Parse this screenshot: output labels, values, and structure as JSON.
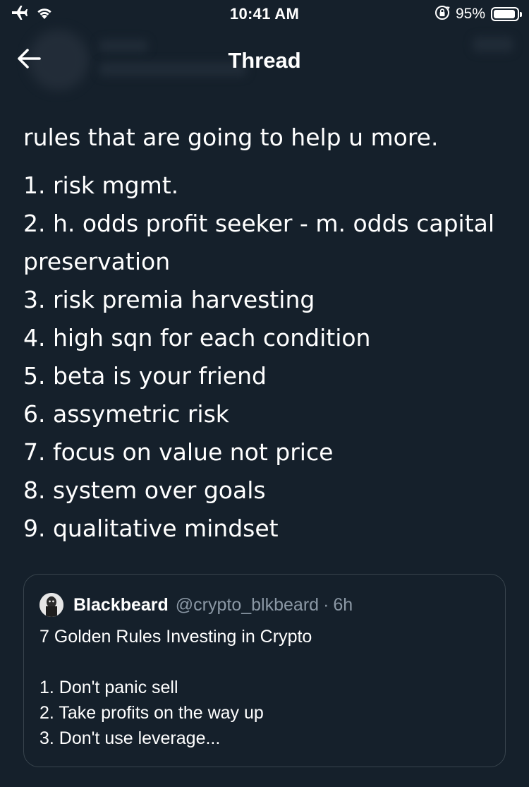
{
  "status_bar": {
    "time": "10:41 AM",
    "battery_percent": "95%",
    "battery_level": 0.95,
    "icons": [
      "airplane-icon",
      "wifi-icon",
      "orientation-lock-icon",
      "battery-icon"
    ]
  },
  "nav": {
    "title": "Thread",
    "back_icon": "back-arrow-icon"
  },
  "tweet": {
    "intro": "rules that are going to help u more.",
    "rules": [
      "1. risk mgmt.",
      "2. h. odds profit seeker - m. odds capital preservation",
      "3. risk premia harvesting",
      "4. high sqn for each condition",
      "5. beta is your friend",
      "6. assymetric risk",
      "7. focus on value not price",
      "8. system over goals",
      "9. qualitative mindset"
    ]
  },
  "quoted_tweet": {
    "author_name": "Blackbeard",
    "handle": "@crypto_blkbeard",
    "separator": "·",
    "time": "6h",
    "headline": "7 Golden Rules Investing in Crypto",
    "lines": [
      "1. Don't panic sell",
      "2. Take profits on the way up",
      "3. Don't use leverage..."
    ]
  },
  "colors": {
    "background": "#15202b",
    "text_primary": "#ffffff",
    "text_secondary": "#8b98a5",
    "border": "#38444d"
  }
}
